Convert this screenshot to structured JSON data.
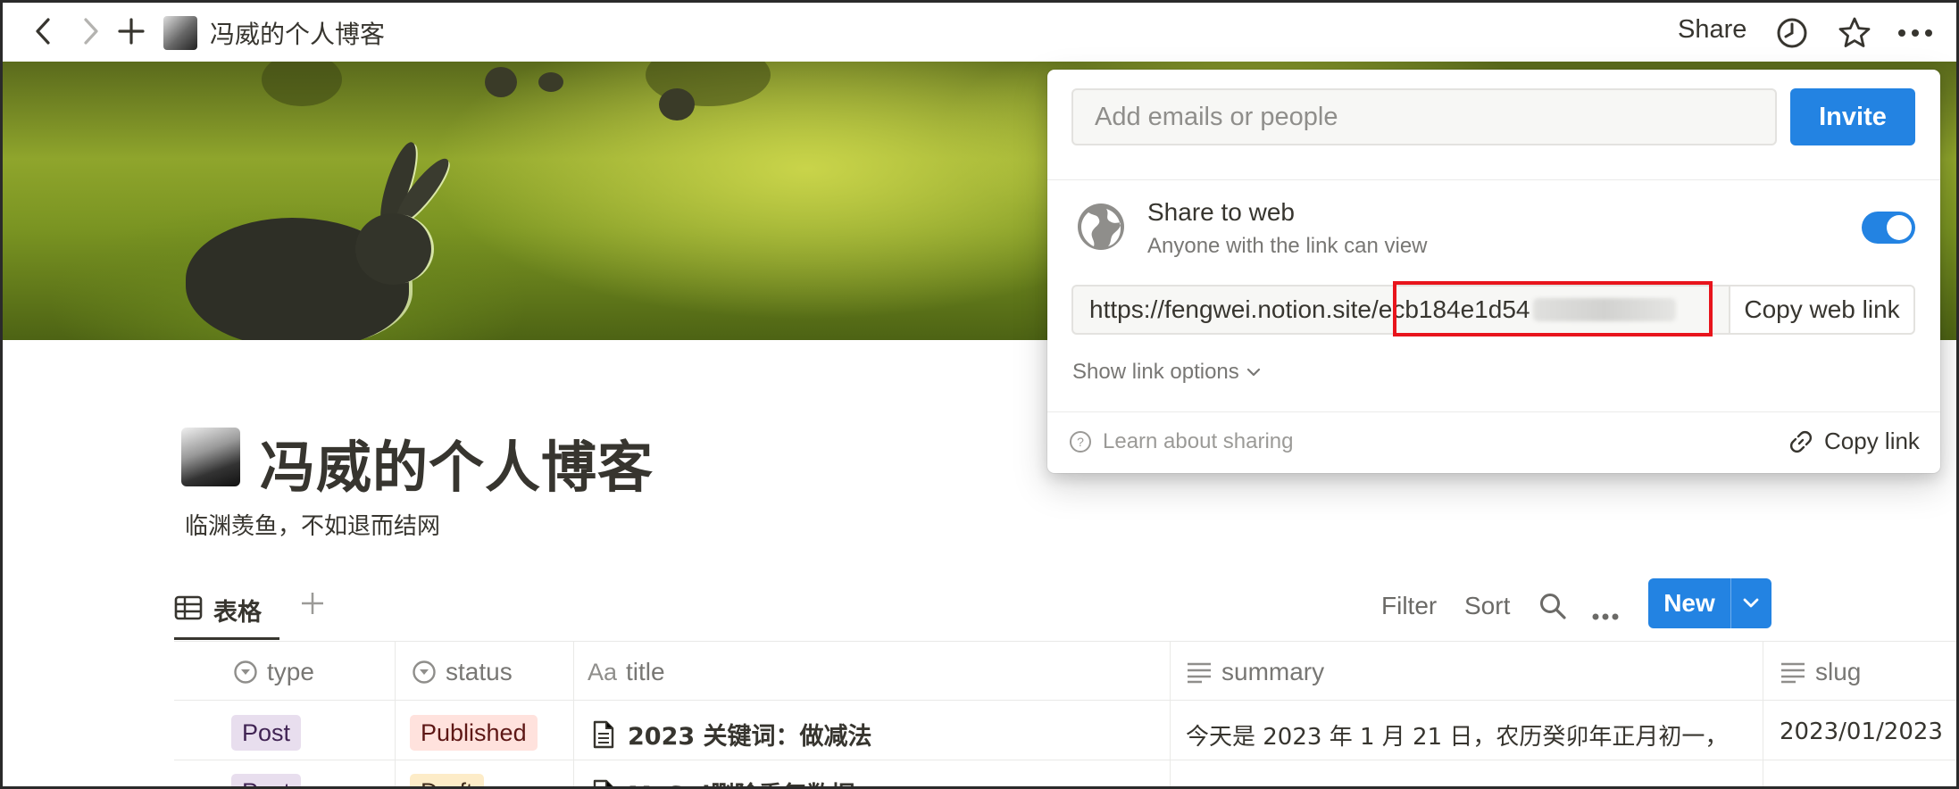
{
  "topbar": {
    "breadcrumb_title": "冯威的个人博客",
    "share_label": "Share",
    "icons": [
      "back-arrow-icon",
      "forward-arrow-icon",
      "plus-icon",
      "clock-icon",
      "star-icon",
      "more-icon"
    ]
  },
  "page": {
    "title": "冯威的个人博客",
    "subtitle": "临渊羡鱼，不如退而结网"
  },
  "views": {
    "active_tab": "表格",
    "toolbar": {
      "filter": "Filter",
      "sort": "Sort",
      "new": "New"
    }
  },
  "table": {
    "columns": [
      {
        "label": "type",
        "icon": "select-icon"
      },
      {
        "label": "status",
        "icon": "select-icon"
      },
      {
        "label": "title",
        "icon": "Aa"
      },
      {
        "label": "summary",
        "icon": "text-lines-icon"
      },
      {
        "label": "slug",
        "icon": "text-lines-icon"
      }
    ],
    "rows": [
      {
        "type": "Post",
        "status": "Published",
        "title": "2023 关键词：做减法",
        "summary": "今天是 2023 年 1 月 21 日，农历癸卯年正月初一，",
        "slug": "2023/01/2023"
      },
      {
        "type": "Post",
        "status": "Draft",
        "title": "MySql删除重复数据",
        "summary": "",
        "slug": ""
      }
    ]
  },
  "share_popup": {
    "email_placeholder": "Add emails or people",
    "invite_label": "Invite",
    "share_to_web_title": "Share to web",
    "share_to_web_subtitle": "Anyone with the link can view",
    "share_to_web_enabled": true,
    "link_prefix": "https://fengwei.notion.site/",
    "link_visible_id": "ecb184e1d54",
    "copy_web_link_label": "Copy web link",
    "show_link_options_label": "Show link options",
    "learn_label": "Learn about sharing",
    "copy_link_label": "Copy link"
  },
  "colors": {
    "accent": "#2383e2",
    "highlight_box": "#e8141c",
    "tag_post_bg": "#e8deee",
    "tag_published_bg": "#ffe2dd",
    "tag_draft_bg": "#fdecc8"
  }
}
